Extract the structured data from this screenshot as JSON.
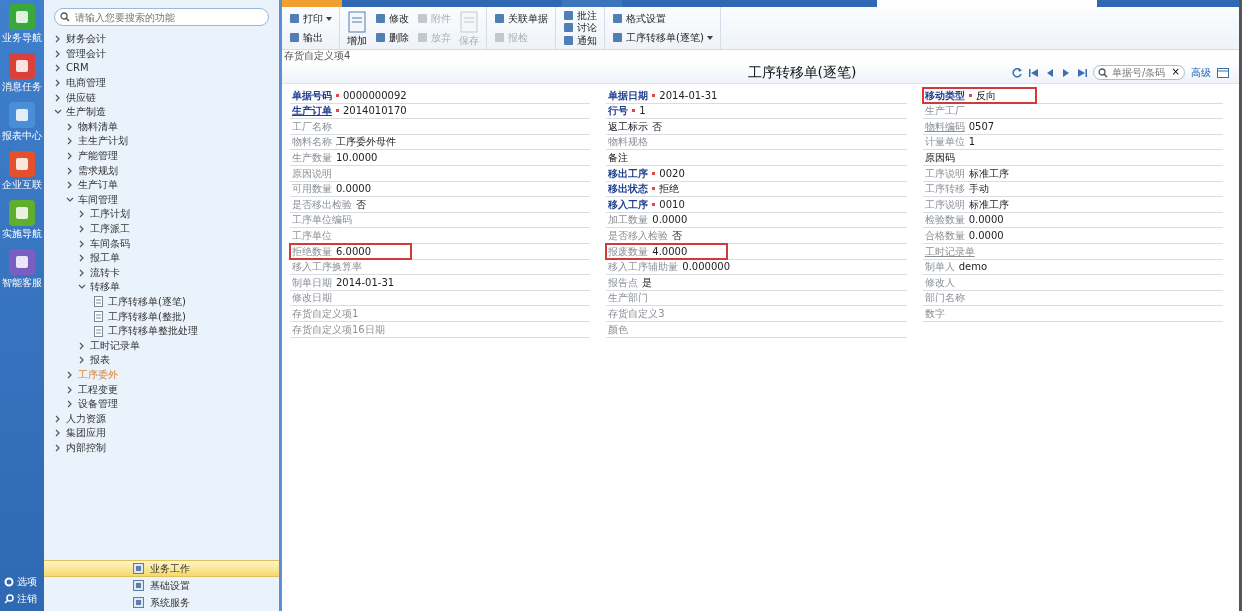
{
  "rail": {
    "items": [
      {
        "label": "业务导航",
        "color": "#3aa83a"
      },
      {
        "label": "消息任务",
        "color": "#d9413a"
      },
      {
        "label": "报表中心",
        "color": "#4a8fd6"
      },
      {
        "label": "企业互联",
        "color": "#e2502c"
      },
      {
        "label": "实施导航",
        "color": "#5fae2e"
      },
      {
        "label": "智能客服",
        "color": "#7a5fc0"
      }
    ],
    "bottom": [
      "选项",
      "注销"
    ]
  },
  "sidebar": {
    "search": {
      "placeholder": "请输入您要搜索的功能"
    },
    "tree": [
      {
        "label": "财务会计",
        "kind": "folder",
        "expanded": false,
        "selected": false
      },
      {
        "label": "管理会计",
        "kind": "folder",
        "expanded": false,
        "selected": false
      },
      {
        "label": "CRM",
        "kind": "folder",
        "expanded": false,
        "selected": false
      },
      {
        "label": "电商管理",
        "kind": "folder",
        "expanded": false,
        "selected": false
      },
      {
        "label": "供应链",
        "kind": "folder",
        "expanded": false,
        "selected": false
      },
      {
        "label": "生产制造",
        "kind": "folder",
        "expanded": true,
        "selected": false,
        "children": [
          {
            "label": "物料清单",
            "kind": "folder",
            "expanded": false,
            "selected": false
          },
          {
            "label": "主生产计划",
            "kind": "folder",
            "expanded": false,
            "selected": false
          },
          {
            "label": "产能管理",
            "kind": "folder",
            "expanded": false,
            "selected": false
          },
          {
            "label": "需求规划",
            "kind": "folder",
            "expanded": false,
            "selected": false
          },
          {
            "label": "生产订单",
            "kind": "folder",
            "expanded": false,
            "selected": false
          },
          {
            "label": "车间管理",
            "kind": "folder",
            "expanded": true,
            "selected": false,
            "children": [
              {
                "label": "工序计划",
                "kind": "folder",
                "expanded": false,
                "selected": false
              },
              {
                "label": "工序派工",
                "kind": "folder",
                "expanded": false,
                "selected": false
              },
              {
                "label": "车间条码",
                "kind": "folder",
                "expanded": false,
                "selected": false
              },
              {
                "label": "报工单",
                "kind": "folder",
                "expanded": false,
                "selected": false
              },
              {
                "label": "流转卡",
                "kind": "folder",
                "expanded": false,
                "selected": false
              },
              {
                "label": "转移单",
                "kind": "folder",
                "expanded": true,
                "selected": false,
                "children": [
                  {
                    "label": "工序转移单(逐笔)",
                    "kind": "doc",
                    "selected": false
                  },
                  {
                    "label": "工序转移单(整批)",
                    "kind": "doc",
                    "selected": false
                  },
                  {
                    "label": "工序转移单整批处理",
                    "kind": "doc",
                    "selected": false
                  }
                ]
              },
              {
                "label": "工时记录单",
                "kind": "folder",
                "expanded": false,
                "selected": false
              },
              {
                "label": "报表",
                "kind": "folder",
                "expanded": false,
                "selected": false
              }
            ]
          },
          {
            "label": "工序委外",
            "kind": "folder",
            "expanded": false,
            "selected": true
          },
          {
            "label": "工程变更",
            "kind": "folder",
            "expanded": false,
            "selected": false
          },
          {
            "label": "设备管理",
            "kind": "folder",
            "expanded": false,
            "selected": false
          }
        ]
      },
      {
        "label": "人力资源",
        "kind": "folder",
        "expanded": false,
        "selected": false
      },
      {
        "label": "集团应用",
        "kind": "folder",
        "expanded": false,
        "selected": false
      },
      {
        "label": "内部控制",
        "kind": "folder",
        "expanded": false,
        "selected": false
      }
    ],
    "sections": [
      {
        "label": "业务工作",
        "selected": true
      },
      {
        "label": "基础设置",
        "selected": false
      },
      {
        "label": "系统服务",
        "selected": false
      }
    ]
  },
  "toolbar": {
    "groups": [
      {
        "columns": [
          {
            "kind": "stack",
            "items": [
              {
                "label": "打印",
                "menu": true,
                "disabled": false
              },
              {
                "label": "输出",
                "menu": false,
                "disabled": false
              }
            ]
          }
        ]
      },
      {
        "columns": [
          {
            "kind": "large",
            "items": [
              {
                "label": "增加",
                "menu": false,
                "disabled": false
              }
            ]
          },
          {
            "kind": "stack",
            "items": [
              {
                "label": "修改",
                "menu": false,
                "disabled": false
              },
              {
                "label": "删除",
                "menu": false,
                "disabled": false
              }
            ]
          },
          {
            "kind": "stack",
            "items": [
              {
                "label": "附件",
                "menu": false,
                "disabled": true
              },
              {
                "label": "放弃",
                "menu": false,
                "disabled": true
              }
            ]
          },
          {
            "kind": "large",
            "items": [
              {
                "label": "保存",
                "menu": false,
                "disabled": true
              }
            ]
          }
        ]
      },
      {
        "columns": [
          {
            "kind": "stack",
            "items": [
              {
                "label": "关联单据",
                "menu": false,
                "disabled": false
              },
              {
                "label": "报检",
                "menu": false,
                "disabled": true
              }
            ]
          }
        ]
      },
      {
        "columns": [
          {
            "kind": "stack",
            "items": [
              {
                "label": "批注",
                "menu": false,
                "disabled": false
              },
              {
                "label": "讨论",
                "menu": false,
                "disabled": false
              },
              {
                "label": "通知",
                "menu": false,
                "disabled": false
              }
            ]
          }
        ]
      },
      {
        "columns": [
          {
            "kind": "stack",
            "items": [
              {
                "label": "格式设置",
                "menu": false,
                "disabled": false
              },
              {
                "label": "工序转移单(逐笔)",
                "menu": true,
                "disabled": false
              }
            ]
          }
        ]
      }
    ]
  },
  "form": {
    "hint": "存货自定义项4",
    "title": "工序转移单(逐笔)",
    "nav": {
      "search_placeholder": "单据号/条码",
      "clear": "×",
      "advanced": "高级"
    },
    "columns": [
      [
        {
          "label": "单据号码",
          "kind": "required",
          "value": "0000000092",
          "outlined": false
        },
        {
          "label": "生产订单",
          "kind": "required-link",
          "value": "2014010170",
          "outlined": false
        },
        {
          "label": "工厂名称",
          "kind": "plain",
          "outlined": false
        },
        {
          "label": "物料名称",
          "kind": "plain",
          "value": "工序委外母件",
          "outlined": false
        },
        {
          "label": "生产数量",
          "kind": "plain",
          "value": "10.0000",
          "outlined": false
        },
        {
          "label": "原因说明",
          "kind": "plain",
          "outlined": false
        },
        {
          "label": "可用数量",
          "kind": "plain",
          "value": "0.0000",
          "outlined": false
        },
        {
          "label": "是否移出检验",
          "kind": "plain",
          "value": "否",
          "outlined": false
        },
        {
          "label": "工序单位编码",
          "kind": "plain",
          "outlined": false
        },
        {
          "label": "工序单位",
          "kind": "plain",
          "outlined": false
        },
        {
          "label": "拒绝数量",
          "kind": "plain",
          "value": "6.0000",
          "outlined": true
        },
        {
          "label": "移入工序换算率",
          "kind": "plain",
          "outlined": false
        },
        {
          "label": "制单日期",
          "kind": "plain",
          "value": "2014-01-31",
          "outlined": false
        },
        {
          "label": "修改日期",
          "kind": "plain",
          "outlined": false
        },
        {
          "label": "存货自定义项1",
          "kind": "plain",
          "outlined": false
        },
        {
          "label": "存货自定义项16日期",
          "kind": "plain",
          "outlined": false
        }
      ],
      [
        {
          "label": "单据日期",
          "kind": "required",
          "value": "2014-01-31",
          "outlined": false
        },
        {
          "label": "行号",
          "kind": "required",
          "value": "1",
          "outlined": false
        },
        {
          "label": "返工标示",
          "kind": "strong",
          "value": "否",
          "outlined": false
        },
        {
          "label": "物料规格",
          "kind": "plain",
          "outlined": false
        },
        {
          "label": "备注",
          "kind": "strong",
          "outlined": false
        },
        {
          "label": "移出工序",
          "kind": "required",
          "value": "0020",
          "outlined": false
        },
        {
          "label": "移出状态",
          "kind": "required",
          "value": "拒绝",
          "outlined": false
        },
        {
          "label": "移入工序",
          "kind": "required",
          "value": "0010",
          "outlined": false
        },
        {
          "label": "加工数量",
          "kind": "plain",
          "value": "0.0000",
          "outlined": false
        },
        {
          "label": "是否移入检验",
          "kind": "plain",
          "value": "否",
          "outlined": false
        },
        {
          "label": "报废数量",
          "kind": "plain",
          "value": "4.0000",
          "outlined": true
        },
        {
          "label": "移入工序辅助量",
          "kind": "plain",
          "value": "0.000000",
          "outlined": false
        },
        {
          "label": "报告点",
          "kind": "plain",
          "value": "是",
          "outlined": false
        },
        {
          "label": "生产部门",
          "kind": "plain",
          "outlined": false
        },
        {
          "label": "存货自定义3",
          "kind": "plain",
          "outlined": false
        },
        {
          "label": "颜色",
          "kind": "plain",
          "outlined": false
        }
      ],
      [
        {
          "label": "移动类型",
          "kind": "required",
          "value": "反向",
          "outlined": true
        },
        {
          "label": "生产工厂",
          "kind": "plain",
          "outlined": false
        },
        {
          "label": "物料编码",
          "kind": "link",
          "value": "0507",
          "outlined": false
        },
        {
          "label": "计量单位",
          "kind": "plain",
          "value": "1",
          "outlined": false
        },
        {
          "label": "原因码",
          "kind": "strong",
          "outlined": false
        },
        {
          "label": "工序说明",
          "kind": "plain",
          "value": "标准工序",
          "outlined": false
        },
        {
          "label": "工序转移",
          "kind": "plain",
          "value": "手动",
          "outlined": false
        },
        {
          "label": "工序说明",
          "kind": "plain",
          "value": "标准工序",
          "outlined": false
        },
        {
          "label": "检验数量",
          "kind": "plain",
          "value": "0.0000",
          "outlined": false
        },
        {
          "label": "合格数量",
          "kind": "plain",
          "value": "0.0000",
          "outlined": false
        },
        {
          "label": "工时记录单",
          "kind": "link",
          "outlined": false
        },
        {
          "label": "制单人",
          "kind": "plain",
          "value": "demo",
          "outlined": false
        },
        {
          "label": "修改人",
          "kind": "plain",
          "outlined": false
        },
        {
          "label": "部门名称",
          "kind": "plain",
          "outlined": false
        },
        {
          "label": "数字",
          "kind": "plain",
          "outlined": false
        }
      ]
    ]
  }
}
